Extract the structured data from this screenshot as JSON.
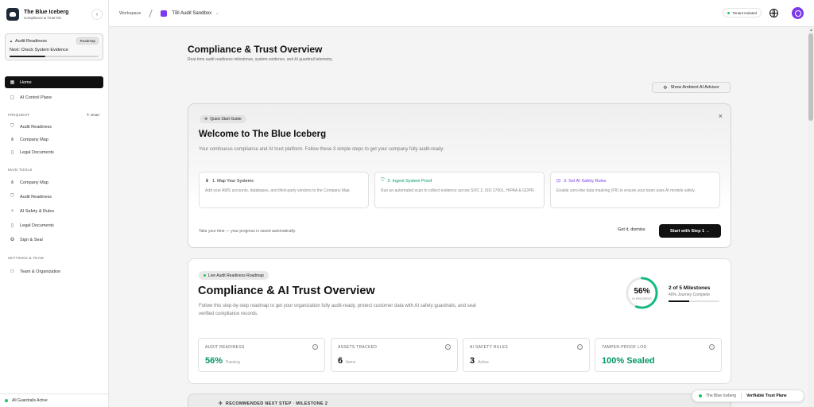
{
  "brand": {
    "title": "The Blue Iceberg",
    "subtitle": "Compliance & Trust OS"
  },
  "readiness_card": {
    "title": "Audit Readiness",
    "badge": "Roadmap",
    "next": "Next: Check System Evidence",
    "progress": 0.4
  },
  "sidebar": {
    "home": "Home",
    "ai_control": "AI Control Plane",
    "frequent_label": "FREQUENT",
    "smart_label": "smart",
    "frequent": [
      "Audit Readiness",
      "Company Map",
      "Legal Documents"
    ],
    "main_tools_label": "MAIN TOOLS",
    "main_tools": [
      "Company Map",
      "Audit Readiness",
      "AI Safety & Rules",
      "Legal Documents",
      "Sign & Seal"
    ],
    "settings_label": "SETTINGS & TEAM",
    "settings": [
      "Team & Organization"
    ],
    "guardrails": "All Guardrails Active"
  },
  "topbar": {
    "workspace": "Workspace",
    "project": "TBI Audit Sandbox",
    "tenant": "Tenant Isolated"
  },
  "page": {
    "title": "Compliance & Trust Overview",
    "subtitle": "Real-time audit readiness milestones, system evidence, and AI guardrail telemetry.",
    "ambient_btn": "Show Ambient AI Advisor"
  },
  "quick_start": {
    "pill": "Quick Start Guide",
    "title": "Welcome to The Blue Iceberg",
    "desc": "Your continuous compliance and AI trust platform. Follow these 3 simple steps to get your company fully audit-ready:",
    "steps": [
      {
        "title": "1. Map Your Systems",
        "desc": "Add your AWS accounts, databases, and third-party vendors to the Company Map.",
        "color": "#111111"
      },
      {
        "title": "2. Ingest System Proof",
        "desc": "Run an automated scan to collect evidence across SOC 2, ISO 27001, HIPAA & GDPR.",
        "color": "#059669"
      },
      {
        "title": "3. Set AI Safety Rules",
        "desc": "Enable zero-line data masking (PII) to ensure your team uses AI models safely.",
        "color": "#7c3aed"
      }
    ],
    "footer": "Take your time — your progress is saved automatically.",
    "dismiss": "Got it, dismiss",
    "start": "Start with Step 1 →"
  },
  "overview": {
    "pill": "Live Audit Readiness Roadmap",
    "title": "Compliance & AI Trust Overview",
    "desc": "Follow this step-by-step roadmap to get your organization fully audit-ready, protect customer data with AI safety guardrails, and seal verified compliance records.",
    "ring_pct": "56%",
    "ring_value": 0.56,
    "ring_sub": "IN PROGRESS",
    "milestones": "2 of 5 Milestones",
    "journey": "40% Journey Complete",
    "journey_value": 0.4,
    "stats": [
      {
        "label": "AUDIT READINESS",
        "num": "56%",
        "unit": "Passing",
        "green": true
      },
      {
        "label": "ASSETS TRACKED",
        "num": "6",
        "unit": "Items",
        "green": false
      },
      {
        "label": "AI SAFETY RULES",
        "num": "3",
        "unit": "Active",
        "green": false
      },
      {
        "label": "TAMPER-PROOF LOG",
        "num": "100% Sealed",
        "unit": "",
        "green": true
      }
    ]
  },
  "recommended": {
    "label": "RECOMMENDED NEXT STEP · MILESTONE 2"
  },
  "trust_pill": {
    "brand": "The Blue Iceberg",
    "label": "Verifiable Trust Plane"
  }
}
